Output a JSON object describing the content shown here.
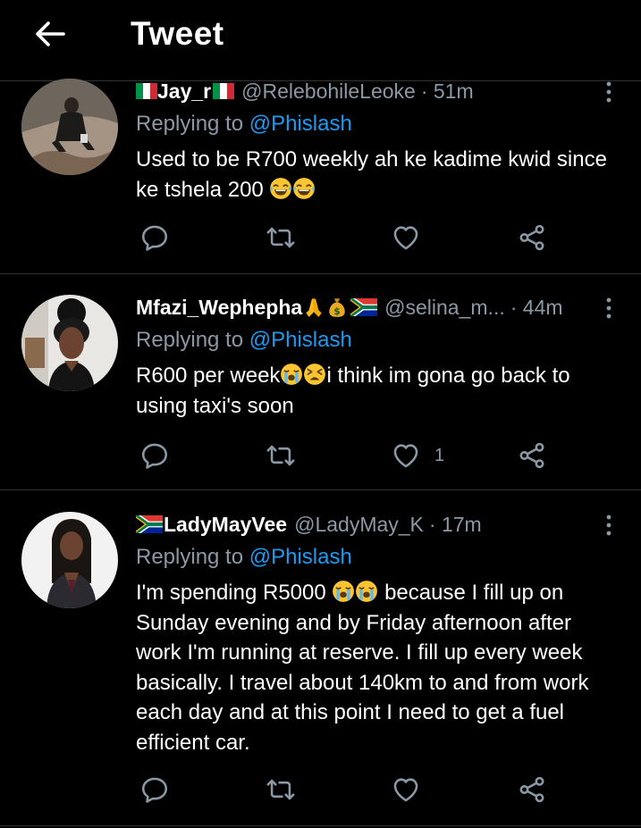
{
  "header": {
    "title": "Tweet",
    "back_icon": "arrow-left-icon"
  },
  "colors": {
    "background": "#000000",
    "text": "#ffffff",
    "secondary": "#8b98a5",
    "link": "#1d9bf0",
    "divider": "#2f3336"
  },
  "tweets": [
    {
      "name": "Jay_r",
      "name_emoji": [
        "italy-flag",
        "italy-flag"
      ],
      "handle": "@RelebohileLeoke",
      "time": "· 51m",
      "reply_prefix": "Replying to",
      "reply_to": "@Phislash",
      "text_line1": "Used to be R700 weekly ah ke kadime kwid since",
      "text_line2": "ke tshela 200",
      "text_emoji": [
        "joy-emoji",
        "joy-emoji"
      ],
      "likes": ""
    },
    {
      "name": "Mfazi_Wephepha",
      "name_emoji": [
        "folded-hands-emoji",
        "money-bag-emoji",
        "south-africa-flag"
      ],
      "handle": "@selina_m...",
      "time": "· 44m",
      "reply_prefix": "Replying to",
      "reply_to": "@Phislash",
      "text_line1a": "R600 per week",
      "text_line1b": "i think im gona go back to",
      "text_line2": "using taxi's soon",
      "text_emoji": [
        "loudly-crying-emoji",
        "tired-face-emoji"
      ],
      "likes": "1"
    },
    {
      "name": "LadyMayVee",
      "name_emoji": [
        "south-africa-flag"
      ],
      "handle": "@LadyMay_K",
      "time": "· 17m",
      "reply_prefix": "Replying to",
      "reply_to": "@Phislash",
      "text_line1a": "I'm spending R5000",
      "text_line1b": "because I fill up on",
      "text_lines": [
        "Sunday evening and by Friday afternoon after",
        "work I'm running at reserve. I fill up every week",
        "basically. I travel about 140km to and from work",
        "each day and at this point I need to get a fuel",
        "efficient car."
      ],
      "text_emoji": [
        "loudly-crying-emoji",
        "loudly-crying-emoji"
      ],
      "likes": ""
    }
  ],
  "action_icons": [
    "reply-icon",
    "retweet-icon",
    "like-icon",
    "share-icon"
  ]
}
